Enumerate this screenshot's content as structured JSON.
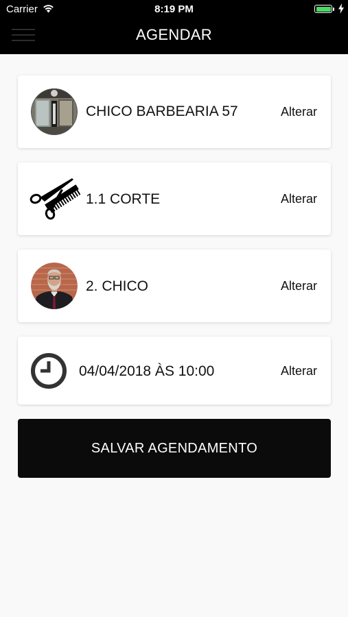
{
  "status_bar": {
    "carrier": "Carrier",
    "time": "8:19 PM",
    "battery_color": "#4cd964"
  },
  "header": {
    "title": "AGENDAR"
  },
  "cards": {
    "shop": {
      "label": "CHICO BARBEARIA 57",
      "action": "Alterar",
      "icon": "barbershop-photo"
    },
    "service": {
      "label": "1.1 CORTE",
      "action": "Alterar",
      "icon": "scissors-comb-icon"
    },
    "barber": {
      "label": "2. CHICO",
      "action": "Alterar",
      "icon": "barber-photo"
    },
    "datetime": {
      "label": "04/04/2018 ÀS 10:00",
      "action": "Alterar",
      "icon": "clock-icon"
    }
  },
  "save_button": {
    "label": "SALVAR AGENDAMENTO"
  }
}
